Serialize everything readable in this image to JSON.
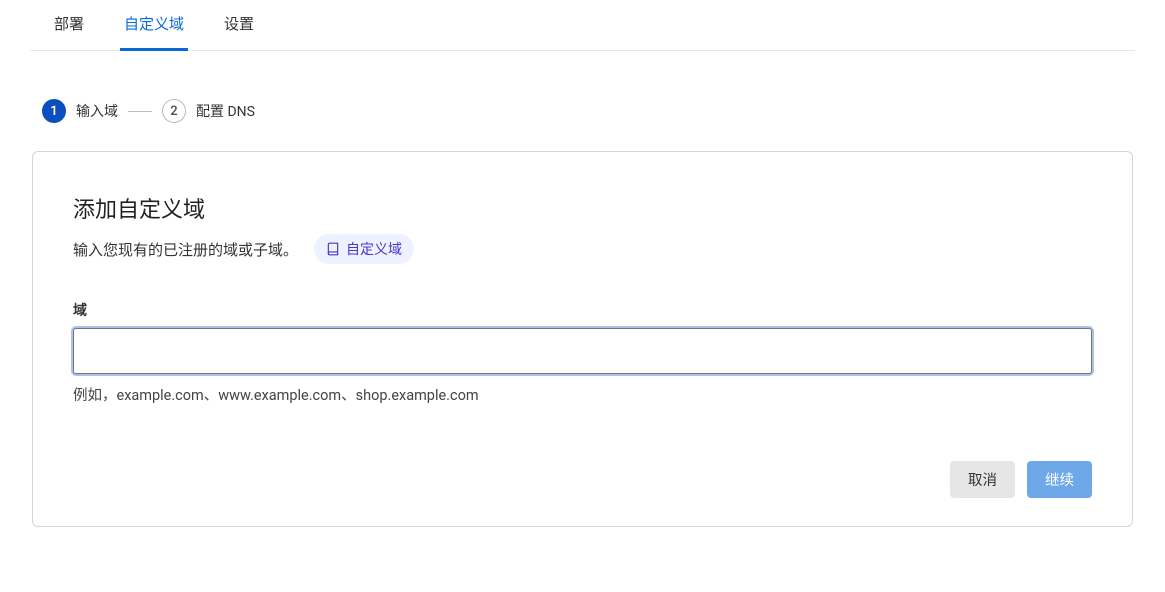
{
  "tabs": [
    {
      "label": "部署",
      "active": false
    },
    {
      "label": "自定义域",
      "active": true
    },
    {
      "label": "设置",
      "active": false
    }
  ],
  "stepper": {
    "step1": {
      "num": "1",
      "label": "输入域"
    },
    "step2": {
      "num": "2",
      "label": "配置 DNS"
    }
  },
  "card": {
    "title": "添加自定义域",
    "description": "输入您现有的已注册的域或子域。",
    "docs_link_label": "自定义域",
    "field_label": "域",
    "field_value": "",
    "field_help": "例如，example.com、www.example.com、shop.example.com"
  },
  "buttons": {
    "cancel": "取消",
    "continue": "继续"
  }
}
